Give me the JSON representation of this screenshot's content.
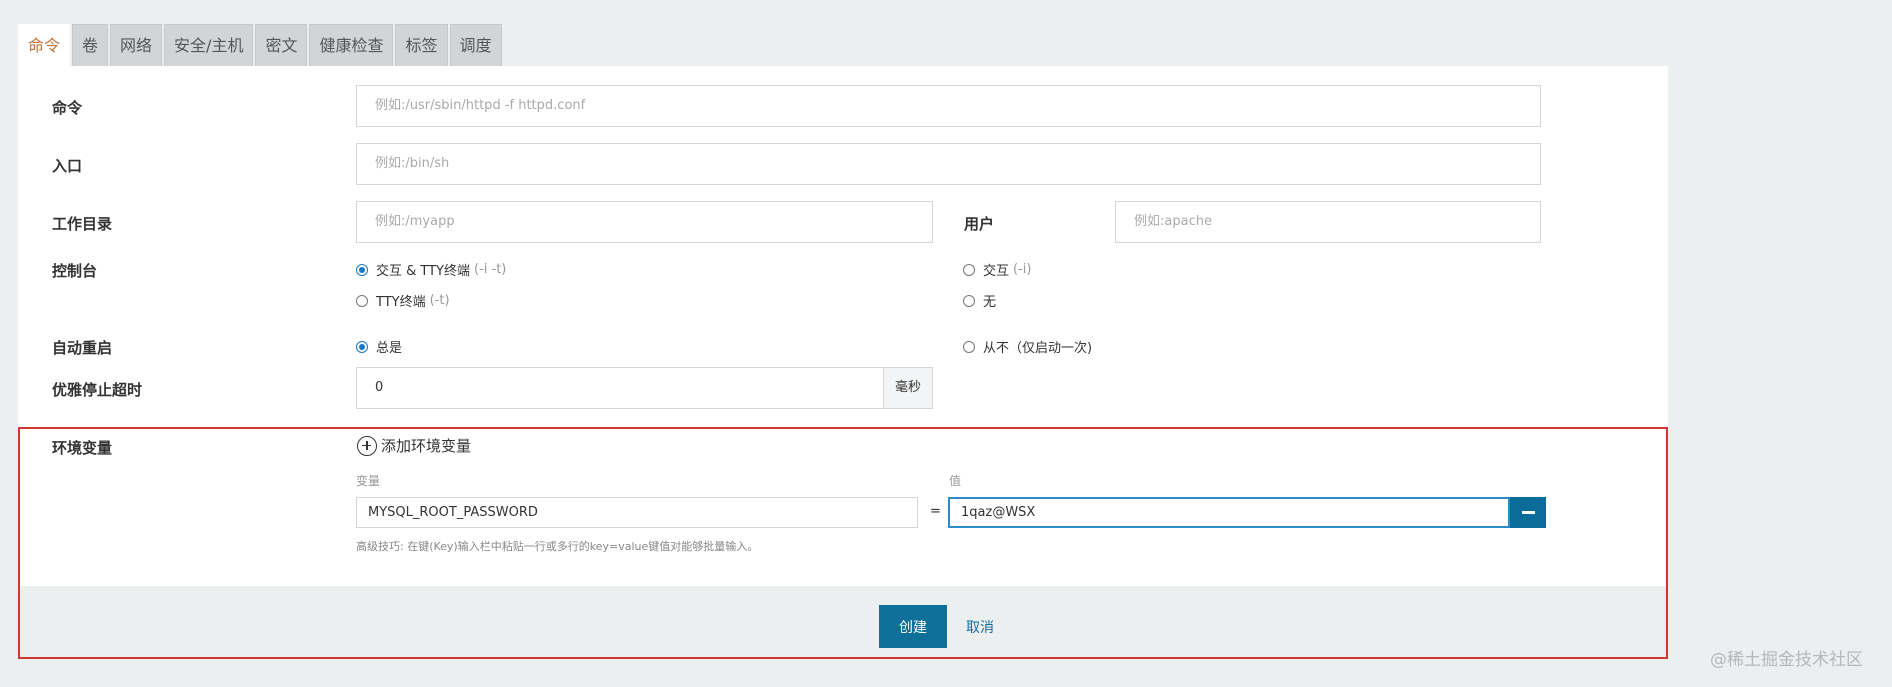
{
  "tabs": [
    {
      "label": "命令",
      "active": true
    },
    {
      "label": "卷"
    },
    {
      "label": "网络"
    },
    {
      "label": "安全/主机"
    },
    {
      "label": "密文"
    },
    {
      "label": "健康检查"
    },
    {
      "label": "标签"
    },
    {
      "label": "调度"
    }
  ],
  "form": {
    "command": {
      "label": "命令",
      "placeholder": "例如:/usr/sbin/httpd -f httpd.conf"
    },
    "entrypoint": {
      "label": "入口",
      "placeholder": "例如:/bin/sh"
    },
    "workdir": {
      "label": "工作目录",
      "placeholder": "例如:/myapp"
    },
    "user": {
      "label": "用户",
      "placeholder": "例如:apache"
    },
    "console": {
      "label": "控制台",
      "options": [
        {
          "text": "交互 & TTY终端",
          "hint": "(-i -t)",
          "checked": true
        },
        {
          "text": "交互",
          "hint": "(-i)",
          "checked": false
        },
        {
          "text": "TTY终端",
          "hint": "(-t)",
          "checked": false
        },
        {
          "text": "无",
          "hint": "",
          "checked": false
        }
      ]
    },
    "restart": {
      "label": "自动重启",
      "options": [
        {
          "text": "总是",
          "checked": true
        },
        {
          "text": "从不（仅启动一次)",
          "checked": false
        }
      ]
    },
    "stop_timeout": {
      "label": "优雅停止超时",
      "value": "0",
      "unit": "毫秒"
    }
  },
  "env": {
    "label": "环境变量",
    "add_label": "添加环境变量",
    "key_header": "变量",
    "value_header": "值",
    "equals": "=",
    "rows": [
      {
        "key": "MYSQL_ROOT_PASSWORD",
        "value": "1qaz@WSX"
      }
    ],
    "tip": "高级技巧: 在键(Key)输入栏中粘贴一行或多行的key=value键值对能够批量输入。"
  },
  "footer": {
    "create_label": "创建",
    "cancel_label": "取消"
  },
  "watermark": "@稀土掘金技术社区",
  "colors": {
    "accent": "#0d6f9a",
    "active_tab_text": "#c8733a",
    "highlight_border": "#d03636"
  }
}
